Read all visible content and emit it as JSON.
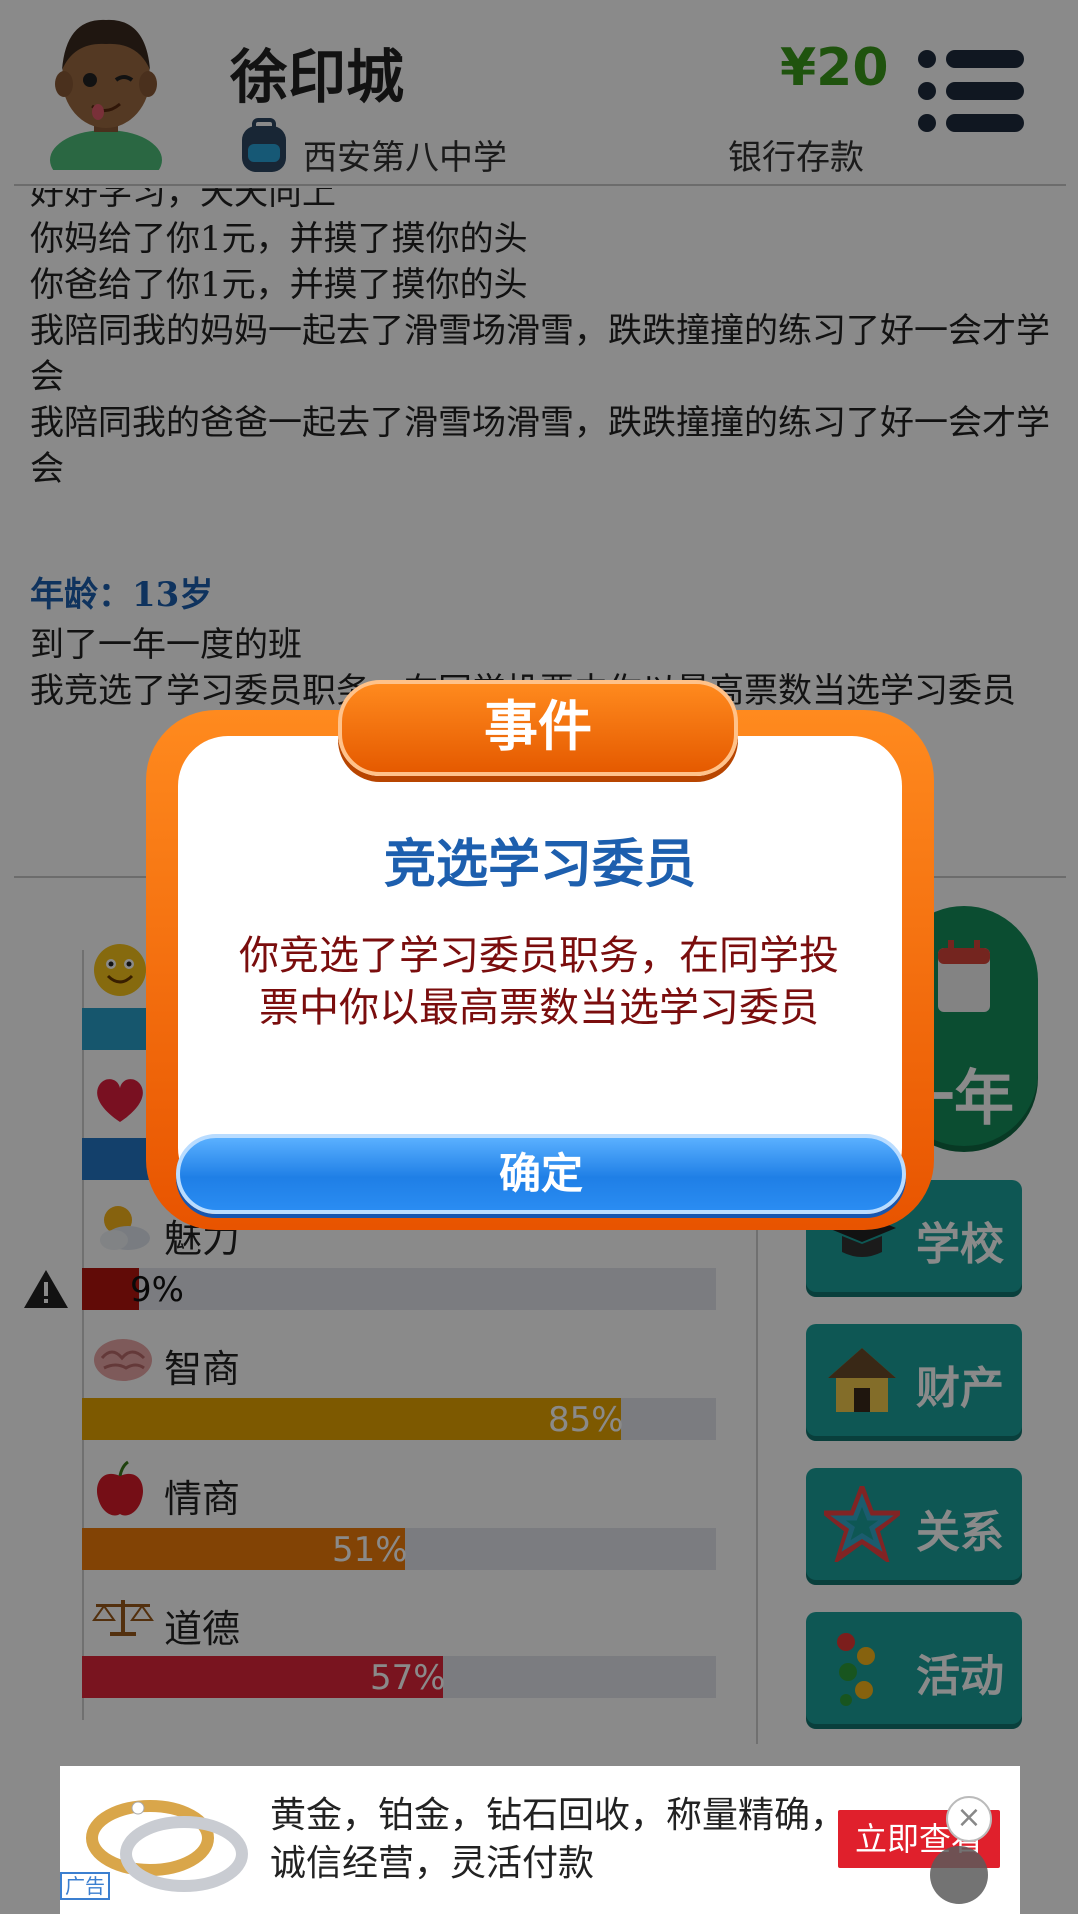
{
  "header": {
    "player_name": "徐印城",
    "school_name": "西安第八中学",
    "money": "¥20",
    "bank_label": "银行存款"
  },
  "log": {
    "first_line": "好好学习，天天向上",
    "lines": [
      "你妈给了你1元，并摸了摸你的头",
      "你爸给了你1元，并摸了摸你的头",
      "我陪同我的妈妈一起去了滑雪场滑雪，跌跌撞撞的练习了好一会才学会",
      "我陪同我的爸爸一起去了滑雪场滑雪，跌跌撞撞的练习了好一会才学会"
    ],
    "age_line": "年龄：13岁",
    "after_age": [
      "到了一年一度的班",
      "我竞选了学习委员职务，在同学投票中你以最高票数当选学习委员"
    ]
  },
  "stats": {
    "charm": {
      "label": "魅力",
      "percent_text": "9%",
      "percent": 9,
      "color": "#b3150e",
      "text_color": "#111111"
    },
    "iq": {
      "label": "智商",
      "percent_text": "85%",
      "percent": 85,
      "color": "#e8a500"
    },
    "eq": {
      "label": "情商",
      "percent_text": "51%",
      "percent": 51,
      "color": "#f07c0a"
    },
    "morality": {
      "label": "道德",
      "percent_text": "57%",
      "percent": 57,
      "color": "#e0253a"
    },
    "happiness": {
      "color": "#2a9fc9"
    },
    "health": {
      "color": "#2477c6"
    }
  },
  "buttons": {
    "next_year": "一年",
    "school": "学校",
    "property": "财产",
    "relations": "关系",
    "activity": "活动"
  },
  "dialog": {
    "header": "事件",
    "title": "竞选学习委员",
    "body": "你竞选了学习委员职务，在同学投票中你以最高票数当选学习委员",
    "confirm": "确定"
  },
  "ad": {
    "tag": "广告",
    "text": "黄金，铂金，钻石回收，称量精确，诚信经营，灵活付款",
    "cta": "立即查看",
    "close": "×"
  }
}
